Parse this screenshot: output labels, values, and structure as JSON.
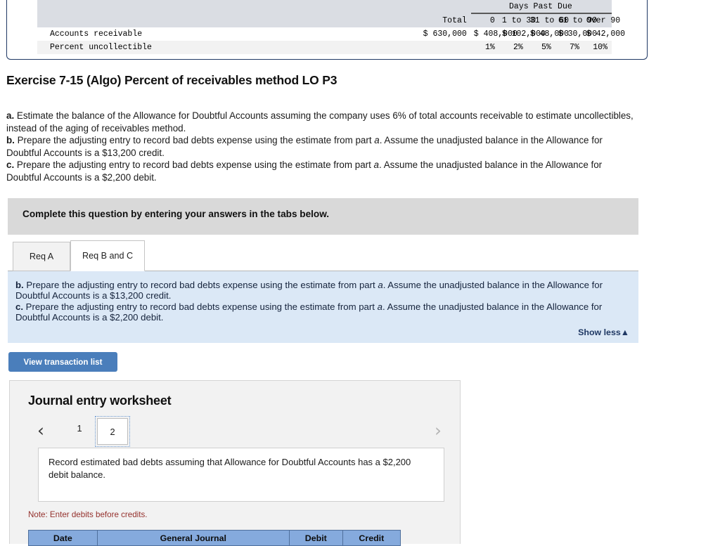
{
  "aging_table": {
    "span_header": "Days Past Due",
    "columns": [
      "",
      "Total",
      "0",
      "1 to 30",
      "31 to 60",
      "61 to 90",
      "Over 90"
    ],
    "rows": [
      {
        "label": "Accounts receivable",
        "values": [
          "$ 630,000",
          "$ 408,000",
          "$ 102,000",
          "$ 48,000",
          "$ 30,000",
          "$ 42,000"
        ]
      },
      {
        "label": "Percent uncollectible",
        "values": [
          "",
          "1%",
          "2%",
          "5%",
          "7%",
          "10%"
        ]
      }
    ]
  },
  "exercise": {
    "title": "Exercise 7-15 (Algo) Percent of receivables method LO P3",
    "requirements": [
      {
        "letter": "a.",
        "text": " Estimate the balance of the Allowance for Doubtful Accounts assuming the company uses 6% of total accounts receivable to estimate uncollectibles, instead of the aging of receivables method."
      },
      {
        "letter": "b.",
        "text_pre": " Prepare the adjusting entry to record bad debts expense using the estimate from part ",
        "italic": "a",
        "text_post": ". Assume the unadjusted balance in the Allowance for Doubtful Accounts is a $13,200 credit."
      },
      {
        "letter": "c.",
        "text_pre": " Prepare the adjusting entry to record bad debts expense using the estimate from part ",
        "italic": "a",
        "text_post": ". Assume the unadjusted balance in the Allowance for Doubtful Accounts is a $2,200 debit."
      }
    ]
  },
  "banner": {
    "text": "Complete this question by entering your answers in the tabs below."
  },
  "tabs": [
    {
      "label": "Req A",
      "active": false
    },
    {
      "label": "Req B and C",
      "active": true
    }
  ],
  "blue_panel": {
    "items": [
      {
        "letter": "b.",
        "text_pre": " Prepare the adjusting entry to record bad debts expense using the estimate from part ",
        "italic": "a",
        "text_post": ". Assume the unadjusted balance in the Allowance for Doubtful Accounts is a $13,200 credit."
      },
      {
        "letter": "c.",
        "text_pre": " Prepare the adjusting entry to record bad debts expense using the estimate from part ",
        "italic": "a",
        "text_post": ". Assume the unadjusted balance in the Allowance for Doubtful Accounts is a $2,200 debit."
      }
    ],
    "show_less_label": "Show less▲"
  },
  "toolbar": {
    "view_transaction_list_label": "View transaction list"
  },
  "worksheet": {
    "title": "Journal entry worksheet",
    "pager": {
      "prev_icon": "‹",
      "next_icon": "›",
      "pages": [
        "1",
        "2"
      ],
      "selected": "2"
    },
    "description": "Record estimated bad debts assuming that Allowance for Doubtful Accounts has a $2,200 debit balance.",
    "note": "Note: Enter debits before credits.",
    "journal_columns": [
      "Date",
      "General Journal",
      "Debit",
      "Credit"
    ]
  },
  "colors": {
    "accent_blue": "#4a7ebb",
    "panel_blue": "#dbe8f6",
    "table_header_blue": "#85aadd",
    "banner_gray": "#d9d9d9",
    "note_red": "#94302c",
    "card_border_navy": "#1f3864"
  }
}
